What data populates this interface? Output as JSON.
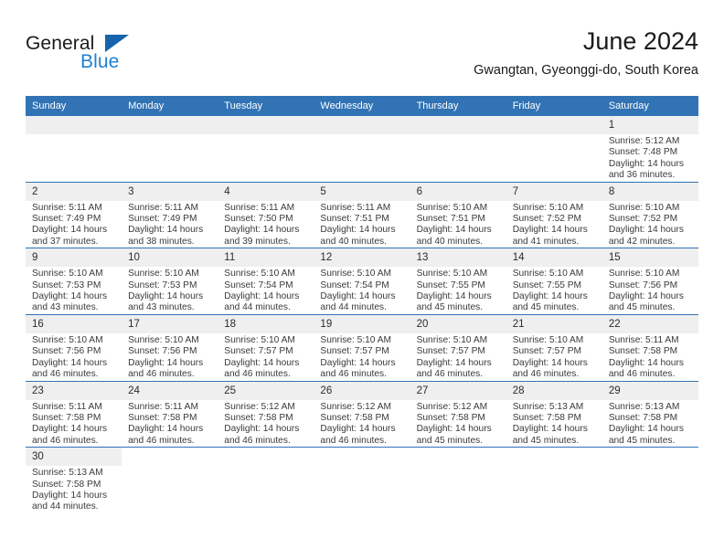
{
  "brand": {
    "name_part1": "General",
    "name_part2": "Blue",
    "flag_icon": "triangle-flag-icon",
    "accent_color": "#1f7fd1",
    "flag_color": "#1664ab"
  },
  "header": {
    "title": "June 2024",
    "subtitle": "Gwangtan, Gyeonggi-do, South Korea"
  },
  "calendar": {
    "header_color": "#3173b4",
    "daynum_band_color": "#efefef",
    "weekdays": [
      "Sunday",
      "Monday",
      "Tuesday",
      "Wednesday",
      "Thursday",
      "Friday",
      "Saturday"
    ],
    "weeks": [
      [
        {
          "day": "",
          "blank": true
        },
        {
          "day": "",
          "blank": true
        },
        {
          "day": "",
          "blank": true
        },
        {
          "day": "",
          "blank": true
        },
        {
          "day": "",
          "blank": true
        },
        {
          "day": "",
          "blank": true
        },
        {
          "day": "1",
          "sunrise": "Sunrise: 5:12 AM",
          "sunset": "Sunset: 7:48 PM",
          "daylight": "Daylight: 14 hours and 36 minutes."
        }
      ],
      [
        {
          "day": "2",
          "sunrise": "Sunrise: 5:11 AM",
          "sunset": "Sunset: 7:49 PM",
          "daylight": "Daylight: 14 hours and 37 minutes."
        },
        {
          "day": "3",
          "sunrise": "Sunrise: 5:11 AM",
          "sunset": "Sunset: 7:49 PM",
          "daylight": "Daylight: 14 hours and 38 minutes."
        },
        {
          "day": "4",
          "sunrise": "Sunrise: 5:11 AM",
          "sunset": "Sunset: 7:50 PM",
          "daylight": "Daylight: 14 hours and 39 minutes."
        },
        {
          "day": "5",
          "sunrise": "Sunrise: 5:11 AM",
          "sunset": "Sunset: 7:51 PM",
          "daylight": "Daylight: 14 hours and 40 minutes."
        },
        {
          "day": "6",
          "sunrise": "Sunrise: 5:10 AM",
          "sunset": "Sunset: 7:51 PM",
          "daylight": "Daylight: 14 hours and 40 minutes."
        },
        {
          "day": "7",
          "sunrise": "Sunrise: 5:10 AM",
          "sunset": "Sunset: 7:52 PM",
          "daylight": "Daylight: 14 hours and 41 minutes."
        },
        {
          "day": "8",
          "sunrise": "Sunrise: 5:10 AM",
          "sunset": "Sunset: 7:52 PM",
          "daylight": "Daylight: 14 hours and 42 minutes."
        }
      ],
      [
        {
          "day": "9",
          "sunrise": "Sunrise: 5:10 AM",
          "sunset": "Sunset: 7:53 PM",
          "daylight": "Daylight: 14 hours and 43 minutes."
        },
        {
          "day": "10",
          "sunrise": "Sunrise: 5:10 AM",
          "sunset": "Sunset: 7:53 PM",
          "daylight": "Daylight: 14 hours and 43 minutes."
        },
        {
          "day": "11",
          "sunrise": "Sunrise: 5:10 AM",
          "sunset": "Sunset: 7:54 PM",
          "daylight": "Daylight: 14 hours and 44 minutes."
        },
        {
          "day": "12",
          "sunrise": "Sunrise: 5:10 AM",
          "sunset": "Sunset: 7:54 PM",
          "daylight": "Daylight: 14 hours and 44 minutes."
        },
        {
          "day": "13",
          "sunrise": "Sunrise: 5:10 AM",
          "sunset": "Sunset: 7:55 PM",
          "daylight": "Daylight: 14 hours and 45 minutes."
        },
        {
          "day": "14",
          "sunrise": "Sunrise: 5:10 AM",
          "sunset": "Sunset: 7:55 PM",
          "daylight": "Daylight: 14 hours and 45 minutes."
        },
        {
          "day": "15",
          "sunrise": "Sunrise: 5:10 AM",
          "sunset": "Sunset: 7:56 PM",
          "daylight": "Daylight: 14 hours and 45 minutes."
        }
      ],
      [
        {
          "day": "16",
          "sunrise": "Sunrise: 5:10 AM",
          "sunset": "Sunset: 7:56 PM",
          "daylight": "Daylight: 14 hours and 46 minutes."
        },
        {
          "day": "17",
          "sunrise": "Sunrise: 5:10 AM",
          "sunset": "Sunset: 7:56 PM",
          "daylight": "Daylight: 14 hours and 46 minutes."
        },
        {
          "day": "18",
          "sunrise": "Sunrise: 5:10 AM",
          "sunset": "Sunset: 7:57 PM",
          "daylight": "Daylight: 14 hours and 46 minutes."
        },
        {
          "day": "19",
          "sunrise": "Sunrise: 5:10 AM",
          "sunset": "Sunset: 7:57 PM",
          "daylight": "Daylight: 14 hours and 46 minutes."
        },
        {
          "day": "20",
          "sunrise": "Sunrise: 5:10 AM",
          "sunset": "Sunset: 7:57 PM",
          "daylight": "Daylight: 14 hours and 46 minutes."
        },
        {
          "day": "21",
          "sunrise": "Sunrise: 5:10 AM",
          "sunset": "Sunset: 7:57 PM",
          "daylight": "Daylight: 14 hours and 46 minutes."
        },
        {
          "day": "22",
          "sunrise": "Sunrise: 5:11 AM",
          "sunset": "Sunset: 7:58 PM",
          "daylight": "Daylight: 14 hours and 46 minutes."
        }
      ],
      [
        {
          "day": "23",
          "sunrise": "Sunrise: 5:11 AM",
          "sunset": "Sunset: 7:58 PM",
          "daylight": "Daylight: 14 hours and 46 minutes."
        },
        {
          "day": "24",
          "sunrise": "Sunrise: 5:11 AM",
          "sunset": "Sunset: 7:58 PM",
          "daylight": "Daylight: 14 hours and 46 minutes."
        },
        {
          "day": "25",
          "sunrise": "Sunrise: 5:12 AM",
          "sunset": "Sunset: 7:58 PM",
          "daylight": "Daylight: 14 hours and 46 minutes."
        },
        {
          "day": "26",
          "sunrise": "Sunrise: 5:12 AM",
          "sunset": "Sunset: 7:58 PM",
          "daylight": "Daylight: 14 hours and 46 minutes."
        },
        {
          "day": "27",
          "sunrise": "Sunrise: 5:12 AM",
          "sunset": "Sunset: 7:58 PM",
          "daylight": "Daylight: 14 hours and 45 minutes."
        },
        {
          "day": "28",
          "sunrise": "Sunrise: 5:13 AM",
          "sunset": "Sunset: 7:58 PM",
          "daylight": "Daylight: 14 hours and 45 minutes."
        },
        {
          "day": "29",
          "sunrise": "Sunrise: 5:13 AM",
          "sunset": "Sunset: 7:58 PM",
          "daylight": "Daylight: 14 hours and 45 minutes."
        }
      ],
      [
        {
          "day": "30",
          "sunrise": "Sunrise: 5:13 AM",
          "sunset": "Sunset: 7:58 PM",
          "daylight": "Daylight: 14 hours and 44 minutes."
        },
        {
          "day": "",
          "blank": true
        },
        {
          "day": "",
          "blank": true
        },
        {
          "day": "",
          "blank": true
        },
        {
          "day": "",
          "blank": true
        },
        {
          "day": "",
          "blank": true
        },
        {
          "day": "",
          "blank": true
        }
      ]
    ]
  }
}
